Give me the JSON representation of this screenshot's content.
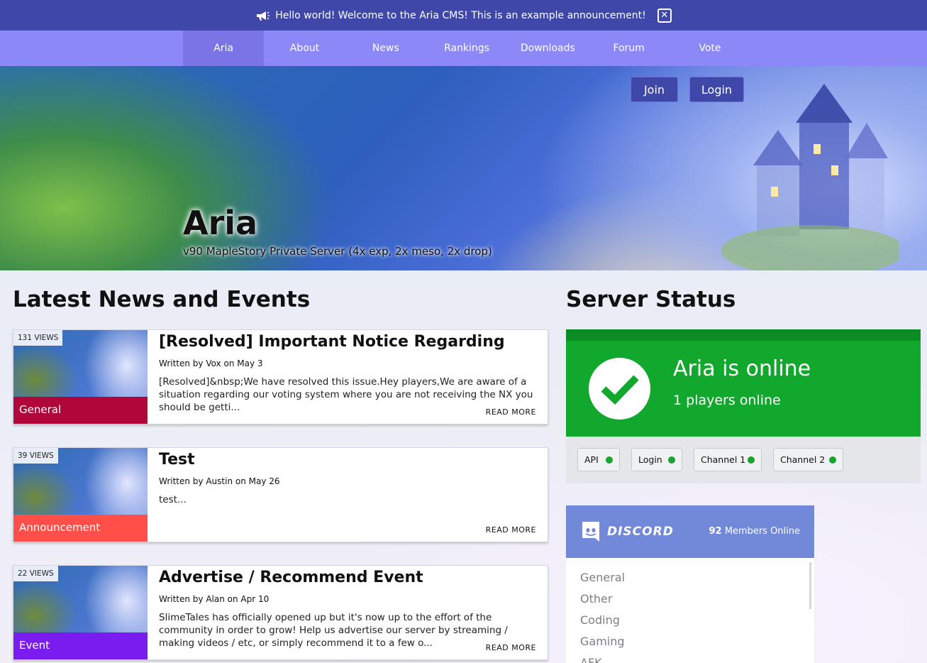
{
  "announcement": {
    "text": "Hello world! Welcome to the Aria CMS! This is an example announcement!",
    "close_label": "✕"
  },
  "nav": {
    "items": [
      {
        "label": "Aria",
        "active": true
      },
      {
        "label": "About"
      },
      {
        "label": "News"
      },
      {
        "label": "Rankings"
      },
      {
        "label": "Downloads"
      },
      {
        "label": "Forum"
      },
      {
        "label": "Vote"
      }
    ]
  },
  "hero": {
    "title": "Aria",
    "subtitle": "v90 MapleStory Private Server (4x exp, 2x meso, 2x drop)",
    "join_label": "Join",
    "login_label": "Login"
  },
  "news": {
    "heading": "Latest News and Events",
    "read_more": "READ MORE",
    "posts": [
      {
        "views": "131 VIEWS",
        "category": "General",
        "category_color": "#b0063a",
        "title": "[Resolved] Important Notice Regarding",
        "meta": "Written by Vox on May 3",
        "excerpt": "[Resolved]&nbsp;We have resolved this issue.Hey players,We are aware of a situation regarding our voting system where you are not receiving the NX you should be getti..."
      },
      {
        "views": "39 VIEWS",
        "category": "Announcement",
        "category_color": "#ff4f48",
        "title": "Test",
        "meta": "Written by Austin on May 26",
        "excerpt": "test..."
      },
      {
        "views": "22 VIEWS",
        "category": "Event",
        "category_color": "#7a1cf0",
        "title": "Advertise / Recommend Event",
        "meta": "Written by Alan on Apr 10",
        "excerpt": "SlimeTales has officially opened up but it's now up to the effort of the community in order to grow! Help us advertise our server by streaming / making videos / etc, or simply recommend it to a few o..."
      }
    ]
  },
  "server_status": {
    "heading": "Server Status",
    "online_text": "Aria is online",
    "players_text": "1 players online",
    "status_color": "#11a82d",
    "services": [
      {
        "label": "API",
        "status": "online"
      },
      {
        "label": "Login",
        "status": "online"
      },
      {
        "label": "Channel 1",
        "status": "online"
      },
      {
        "label": "Channel 2",
        "status": "online"
      }
    ]
  },
  "discord": {
    "logo_text": "DISCORD",
    "members_count": "92",
    "members_label": "Members Online",
    "channels": [
      "General",
      "Other",
      "Coding",
      "Gaming",
      "AFK"
    ],
    "brand_color": "#7289da"
  }
}
